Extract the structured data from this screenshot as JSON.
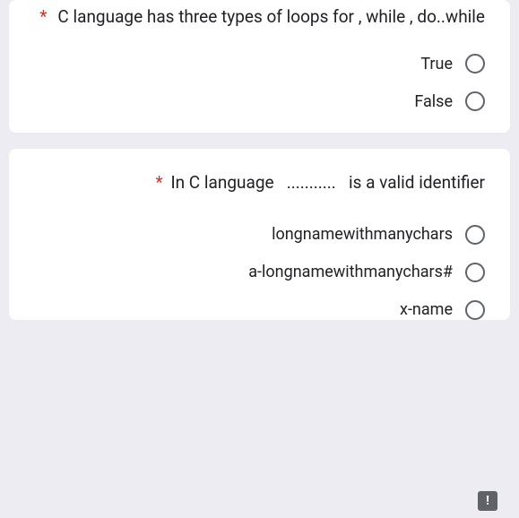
{
  "q1": {
    "required_mark": "*",
    "text": "C language has three types of loops  for , while , do..while",
    "options": [
      {
        "label": "True"
      },
      {
        "label": "False"
      }
    ]
  },
  "q2": {
    "required_mark": "*",
    "text_prefix": "In C language",
    "text_dots": "...........",
    "text_suffix": "is a valid identifier",
    "options": [
      {
        "label": "longnamewithmanychars"
      },
      {
        "label": "a-longnamewithmanychars#"
      },
      {
        "label": "x-name"
      }
    ]
  },
  "alert": {
    "symbol": "!"
  }
}
